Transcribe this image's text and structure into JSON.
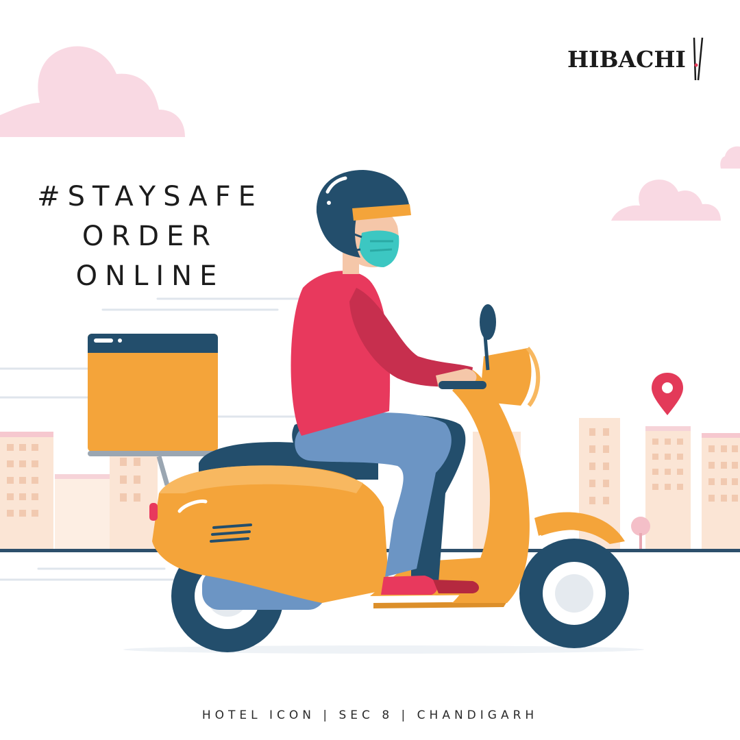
{
  "brand": {
    "name": "HIBACHI",
    "logo_icon": "chopsticks-icon"
  },
  "headline": {
    "line1": "#STAYSAFE",
    "line2": "ORDER",
    "line3": "ONLINE"
  },
  "footer": {
    "address": "HOTEL ICON | SEC 8 | CHANDIGARH"
  },
  "colors": {
    "cloud": "#f9d9e3",
    "helmet": "#234e6c",
    "scooter": "#f4a43a",
    "shirt": "#e8395d",
    "jeans": "#6c95c4",
    "mask": "#3cc7c2",
    "buildings": "#fbe5d5",
    "location_pin": "#e33a59"
  },
  "illustration": {
    "subject": "delivery-rider-on-scooter",
    "icons": [
      "helmet-icon",
      "face-mask-icon",
      "delivery-box-icon",
      "scooter-icon",
      "location-pin-icon",
      "cloud-icon"
    ]
  }
}
